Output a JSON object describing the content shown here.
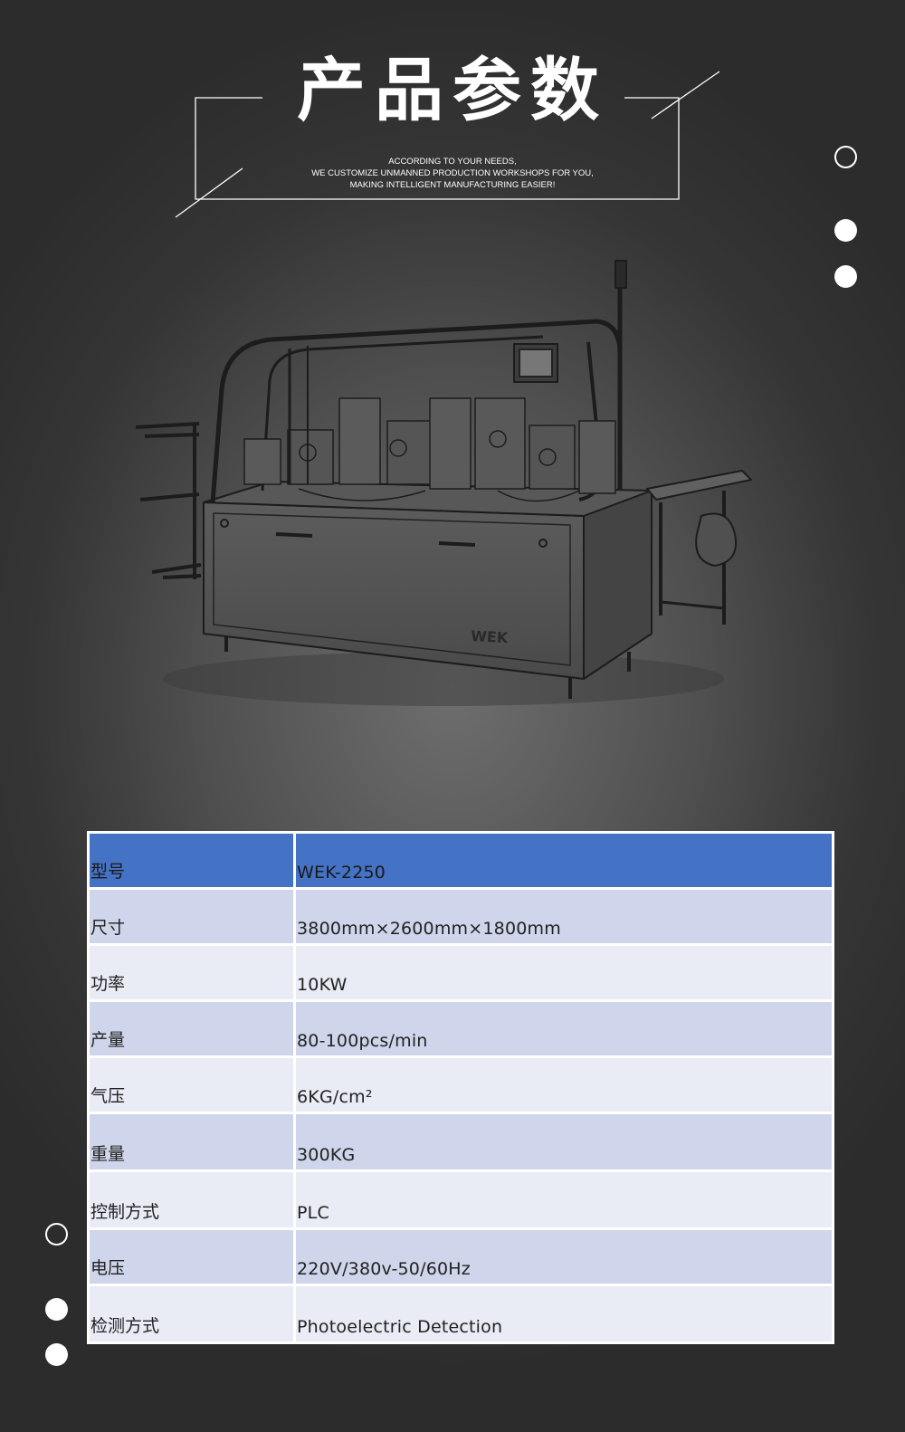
{
  "header": {
    "title": "产品参数",
    "subtitle_lines": [
      "ACCORDING TO YOUR NEEDS,",
      "WE CUSTOMIZE UNMANNED PRODUCTION WORKSHOPS FOR YOU,",
      "MAKING INTELLIGENT MANUFACTURING EASIER!"
    ]
  },
  "machine": {
    "brand_mark": "WEK"
  },
  "specs": [
    {
      "label": "型号",
      "value": "WEK-2250"
    },
    {
      "label": "尺寸",
      "value": "3800mm×2600mm×1800mm"
    },
    {
      "label": "功率",
      "value": "10KW"
    },
    {
      "label": "产量",
      "value": "80-100pcs/min"
    },
    {
      "label": "气压",
      "value": "6KG/cm²"
    },
    {
      "label": "重量",
      "value": "300KG"
    },
    {
      "label": "控制方式",
      "value": "PLC"
    },
    {
      "label": "电压",
      "value": "220V/380v-50/60Hz"
    },
    {
      "label": "检测方式",
      "value": "Photoelectric Detection"
    }
  ],
  "colors": {
    "header_row": "#4472c4",
    "row_odd": "#cfd5ea",
    "row_even": "#e9ebf5"
  }
}
